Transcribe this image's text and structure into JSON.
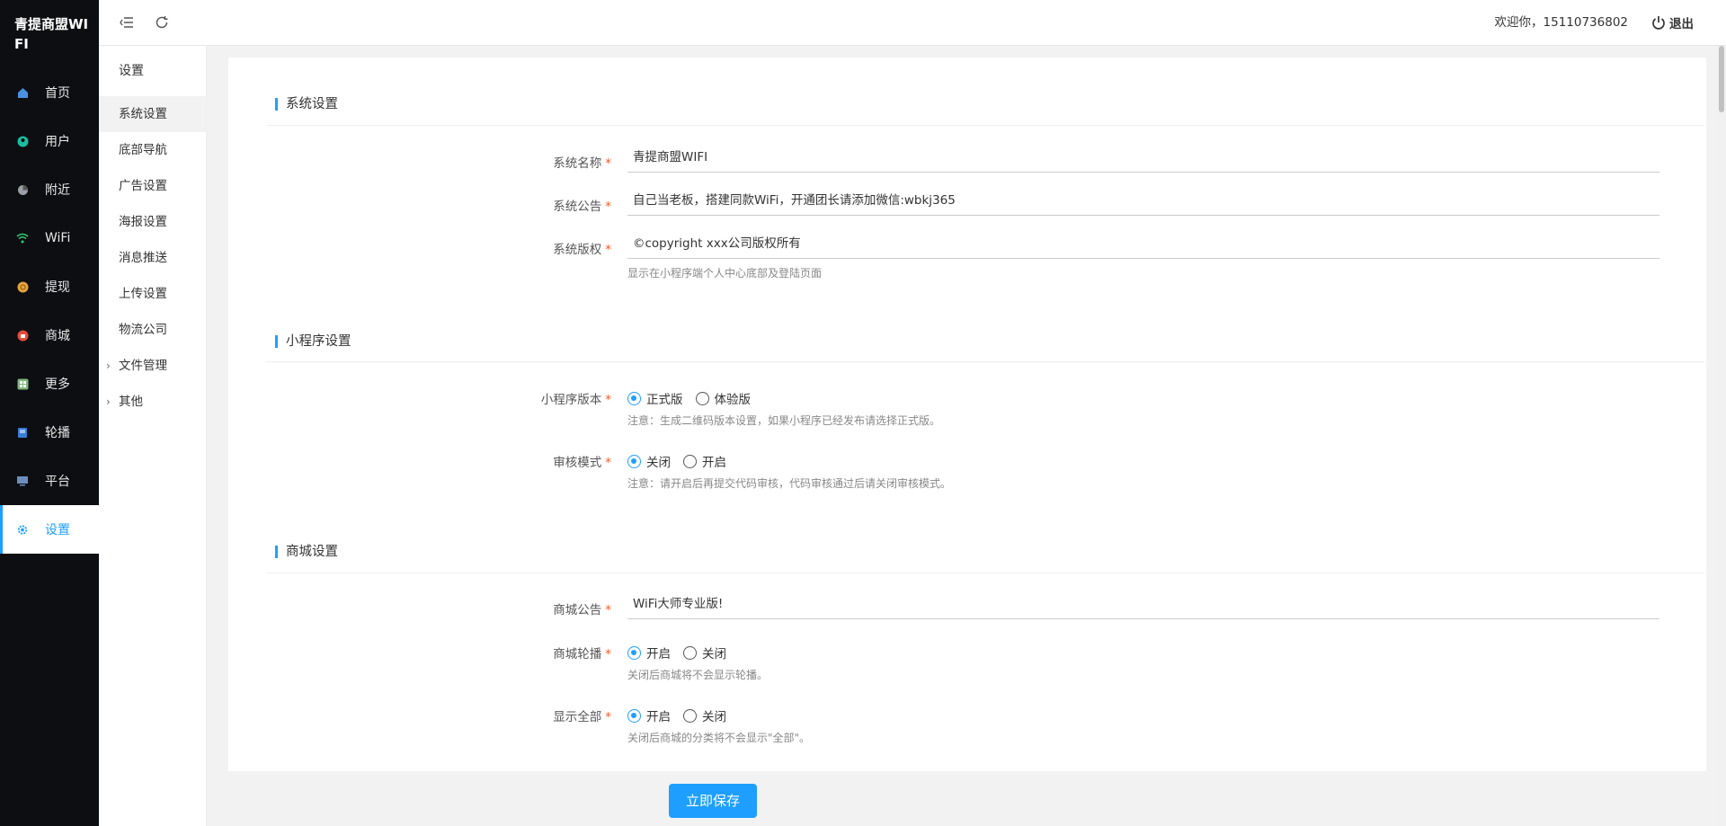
{
  "app": {
    "brand": "青提商盟WIFI"
  },
  "sidebar": {
    "items": [
      {
        "label": "首页",
        "icon": "home-icon",
        "color": "#4a90e2"
      },
      {
        "label": "用户",
        "icon": "user-icon",
        "color": "#1abc9c"
      },
      {
        "label": "附近",
        "icon": "location-icon",
        "color": "#9aa0a6"
      },
      {
        "label": "WiFi",
        "icon": "wifi-icon",
        "color": "#2ecc71"
      },
      {
        "label": "提现",
        "icon": "coin-icon",
        "color": "#e6a23c"
      },
      {
        "label": "商城",
        "icon": "shop-icon",
        "color": "#e74c3c"
      },
      {
        "label": "更多",
        "icon": "grid-icon",
        "color": "#7fb77e"
      },
      {
        "label": "轮播",
        "icon": "carousel-icon",
        "color": "#3a7bd5"
      },
      {
        "label": "平台",
        "icon": "monitor-icon",
        "color": "#6c8ebf"
      },
      {
        "label": "设置",
        "icon": "gear-icon",
        "color": "#1E9FFF",
        "active": true
      }
    ]
  },
  "submenu": {
    "title": "设置",
    "items": [
      {
        "label": "系统设置",
        "active": true
      },
      {
        "label": "底部导航"
      },
      {
        "label": "广告设置"
      },
      {
        "label": "海报设置"
      },
      {
        "label": "消息推送"
      },
      {
        "label": "上传设置"
      },
      {
        "label": "物流公司"
      },
      {
        "label": "文件管理",
        "expandable": true
      },
      {
        "label": "其他",
        "expandable": true
      }
    ]
  },
  "header": {
    "welcome": "欢迎你，15110736802",
    "logout": "退出"
  },
  "sections": {
    "system": {
      "title": "系统设置",
      "name_label": "系统名称",
      "name_value": "青提商盟WIFI",
      "notice_label": "系统公告",
      "notice_value": "自己当老板，搭建同款WiFi，开通团长请添加微信:wbkj365",
      "copyright_label": "系统版权",
      "copyright_value": "©copyright xxx公司版权所有",
      "copyright_hint": "显示在小程序端个人中心底部及登陆页面"
    },
    "miniprogram": {
      "title": "小程序设置",
      "version_label": "小程序版本",
      "version_options": [
        "正式版",
        "体验版"
      ],
      "version_selected": "正式版",
      "version_hint": "注意：生成二维码版本设置，如果小程序已经发布请选择正式版。",
      "review_label": "审核模式",
      "review_options": [
        "关闭",
        "开启"
      ],
      "review_selected": "关闭",
      "review_hint": "注意：请开启后再提交代码审核，代码审核通过后请关闭审核模式。"
    },
    "shop": {
      "title": "商城设置",
      "notice_label": "商城公告",
      "notice_value": "WiFi大师专业版!",
      "carousel_label": "商城轮播",
      "carousel_options": [
        "开启",
        "关闭"
      ],
      "carousel_selected": "开启",
      "carousel_hint": "关闭后商城将不会显示轮播。",
      "showall_label": "显示全部",
      "showall_options": [
        "开启",
        "关闭"
      ],
      "showall_selected": "开启",
      "showall_hint": "关闭后商城的分类将不会显示\"全部\"。"
    }
  },
  "actions": {
    "save": "立即保存"
  },
  "colors": {
    "accent": "#1E9FFF",
    "required": "#ff5722",
    "sidebar_bg": "#0c0e12"
  }
}
